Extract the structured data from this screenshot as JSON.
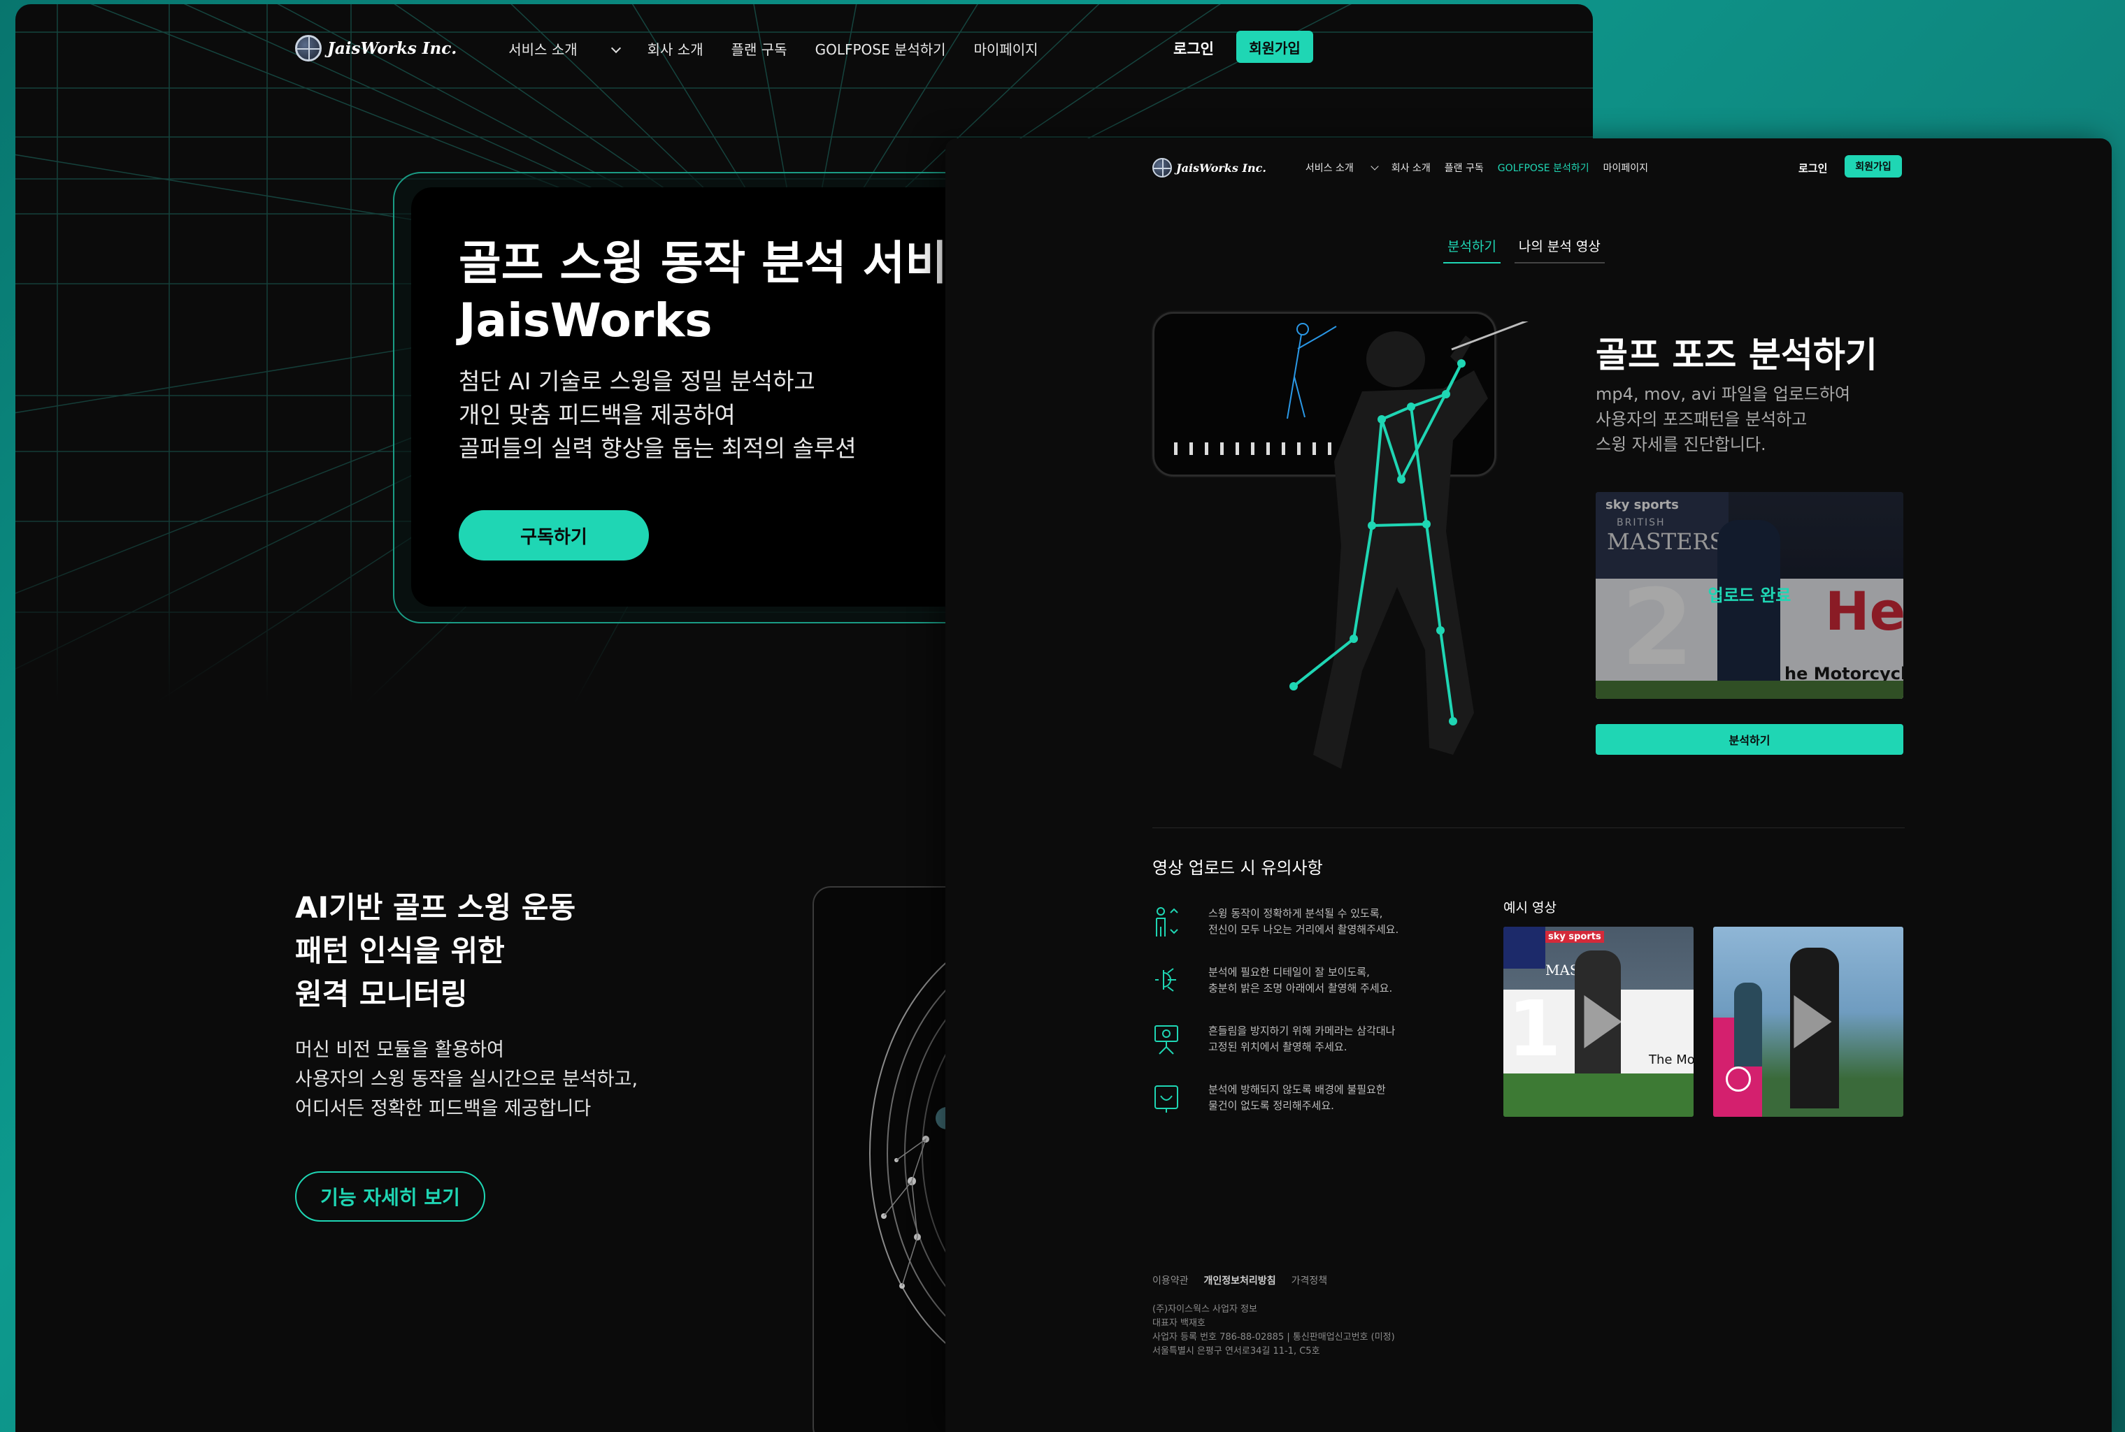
{
  "colors": {
    "accent": "#1fd6b4",
    "background": "#0b0b0b",
    "page_bg": "#0d9a8e"
  },
  "brand": {
    "name": "JaisWorks Inc."
  },
  "nav": {
    "items": [
      "서비스 소개",
      "회사 소개",
      "플랜 구독",
      "GOLFPOSE 분석하기",
      "마이페이지"
    ],
    "login": "로그인",
    "signup": "회원가입"
  },
  "landing": {
    "hero": {
      "title_line1": "골프 스윙 동작 분석 서비스",
      "title_line2": "JaisWorks",
      "desc_line1": "첨단 AI 기술로 스윙을 정밀 분석하고",
      "desc_line2": "개인 맞춤 피드백을 제공하여",
      "desc_line3": "골퍼들의 실력 향상을 돕는 최적의 솔루션",
      "cta": "구독하기"
    },
    "section2": {
      "title_line1": "AI기반 골프 스윙 운동",
      "title_line2": "패턴 인식을 위한",
      "title_line3": "원격 모니터링",
      "desc_line1": "머신 비전 모듈을 활용하여",
      "desc_line2": "사용자의 스윙 동작을 실시간으로 분석하고,",
      "desc_line3": "어디서든 정확한 피드백을 제공합니다",
      "cta": "기능 자세히 보기"
    }
  },
  "analysis": {
    "tabs": [
      "분석하기",
      "나의 분석 영상"
    ],
    "title": "골프 포즈 분석하기",
    "desc_line1": "mp4, mov, avi 파일을 업로드하여",
    "desc_line2": "사용자의 포즈패턴을 분석하고",
    "desc_line3": "스윙 자세를 진단합니다.",
    "preview": {
      "status": "업로드 완료",
      "sponsor": "sky sports",
      "event_sub": "BRITISH",
      "event": "MASTERS",
      "banner": "He",
      "banner_sub": "he Motorcycle",
      "number": "2"
    },
    "analyze_button": "분석하기",
    "notice_title": "영상 업로드 시 유의사항",
    "notes": [
      {
        "icon": "person-frame-icon",
        "line1": "스윙 동작이 정확하게 분석될 수 있도록,",
        "line2": "전신이 모두 나오는 거리에서 촬영해주세요."
      },
      {
        "icon": "light-bulb-icon",
        "line1": "분석에 필요한 디테일이 잘 보이도록,",
        "line2": "충분히 밝은 조명 아래에서 촬영해 주세요."
      },
      {
        "icon": "tripod-camera-icon",
        "line1": "흔들림을 방지하기 위해 카메라는 삼각대나",
        "line2": "고정된 위치에서 촬영해 주세요."
      },
      {
        "icon": "clean-background-icon",
        "line1": "분석에 방해되지 않도록 배경에 불필요한",
        "line2": "물건이 없도록 정리해주세요."
      }
    ],
    "examples_title": "예시 영상",
    "examples": [
      {
        "sponsor": "sky sports",
        "event": "MASTE",
        "banner": "The Mot",
        "number": "1"
      },
      {
        "sponsor": "",
        "event": "",
        "banner": "",
        "number": ""
      }
    ]
  },
  "footer": {
    "links": [
      "이용약관",
      "개인정보처리방침",
      "가격정책"
    ],
    "company": "(주)자이스웍스 사업자 정보",
    "ceo": "대표자 백재호",
    "registration": "사업자 등록 번호 786-88-02885  |  통신판매업신고번호 (미정)",
    "address": "서울특별시 은평구 연서로34길 11-1, C5호"
  }
}
